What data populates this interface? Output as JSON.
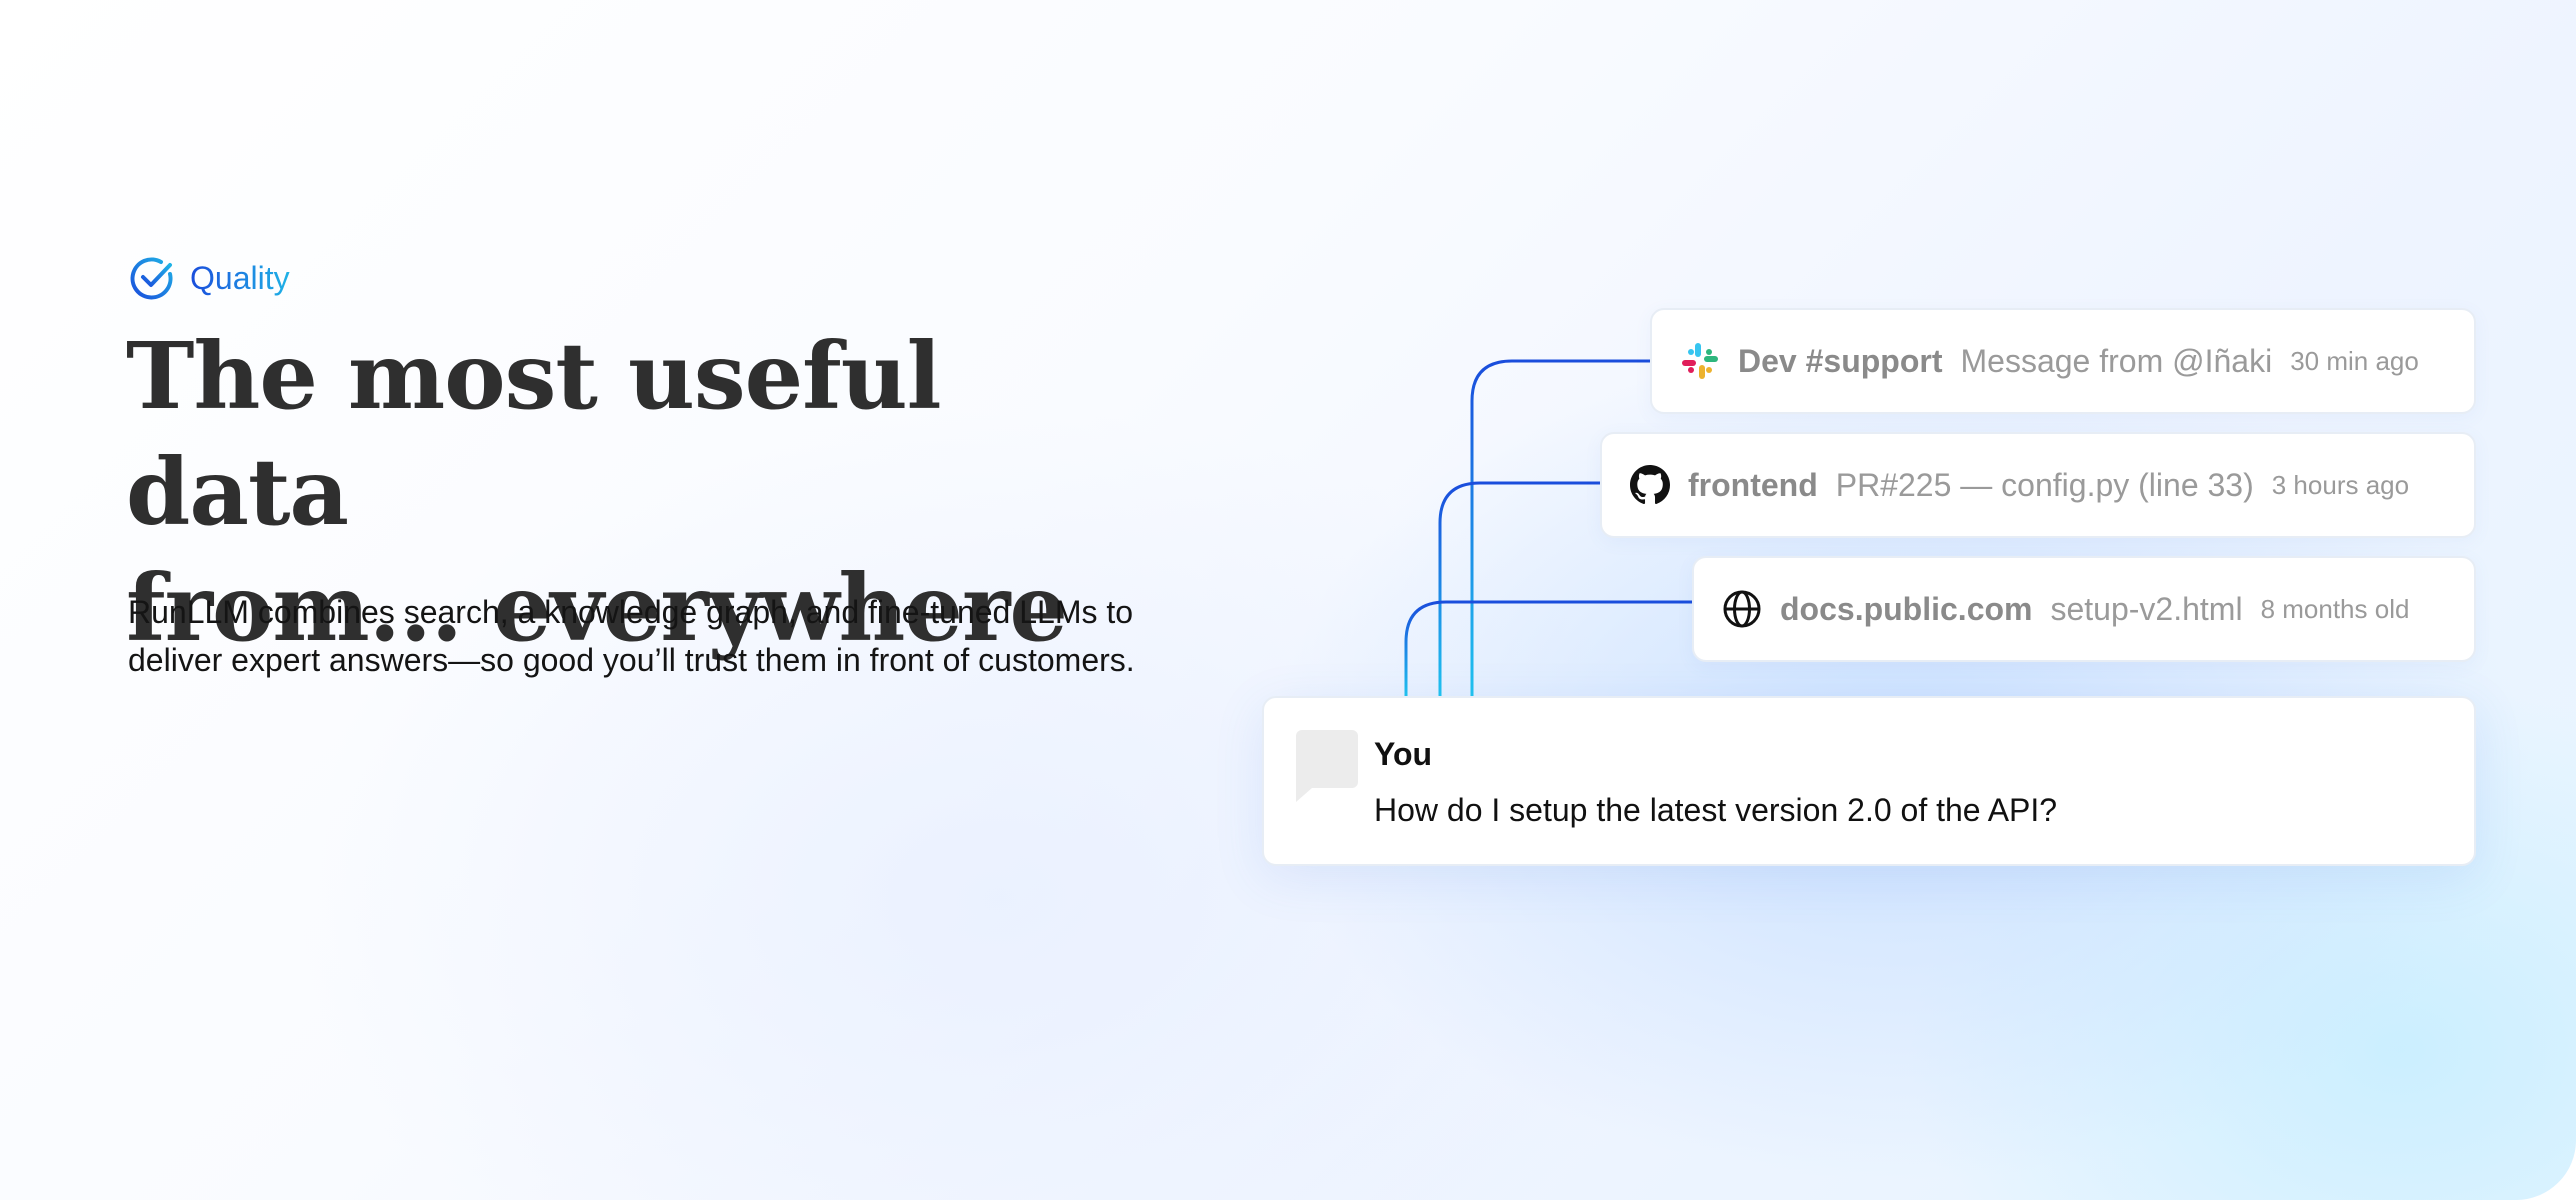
{
  "tag": {
    "label": "Quality",
    "icon": "check-circle-icon"
  },
  "headline": {
    "line1": "The most useful data",
    "line2": "from... everywhere"
  },
  "description": "RunLLM combines search, a knowledge graph, and fine-tuned LLMs to deliver expert answers—so good you’ll trust them in front of customers.",
  "sources": [
    {
      "icon": "slack-icon",
      "name": "Dev #support",
      "detail": "Message from @Iñaki",
      "age": "30 min ago"
    },
    {
      "icon": "github-icon",
      "name": "frontend",
      "detail": "PR#225 — config.py (line 33)",
      "age": "3 hours ago"
    },
    {
      "icon": "globe-icon",
      "name": "docs.public.com",
      "detail": "setup-v2.html",
      "age": "8 months old"
    }
  ],
  "chat": {
    "avatar_icon": "chat-bubble-icon",
    "author": "You",
    "message": "How do I setup the latest version 2.0 of the API?"
  },
  "colors": {
    "accent_blue": "#1a4ddc",
    "accent_cyan": "#1fb3e6",
    "heading": "#2f2f2f"
  }
}
